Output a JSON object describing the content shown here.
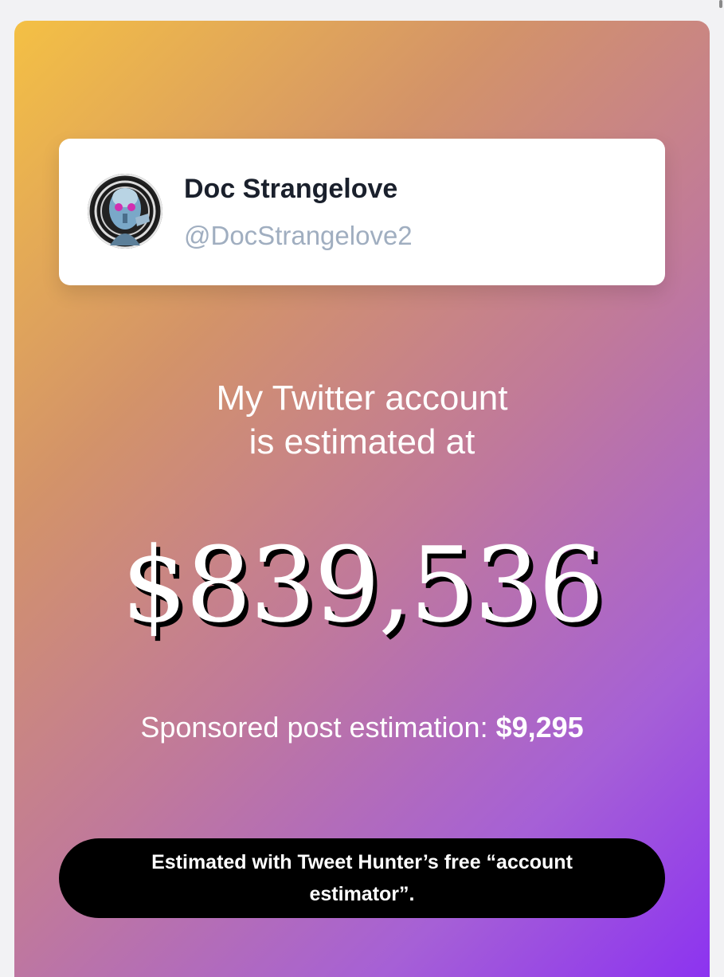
{
  "profile": {
    "name": "Doc Strangelove",
    "handle": "@DocStrangelove2",
    "avatar_icon": "profile-avatar"
  },
  "headline": {
    "line1": "My Twitter account",
    "line2": "is estimated at"
  },
  "estimate": {
    "amount": "$839,536"
  },
  "sponsored": {
    "label": "Sponsored post estimation: ",
    "value": "$9,295"
  },
  "cta": {
    "text": "Estimated with Tweet Hunter’s free “account estimator”."
  },
  "colors": {
    "gradient_start": "#f4c044",
    "gradient_end": "#8c33f0",
    "cta_background": "#000000",
    "card_background": "#ffffff",
    "name_color": "#1a202c",
    "handle_color": "#a0aec0"
  }
}
